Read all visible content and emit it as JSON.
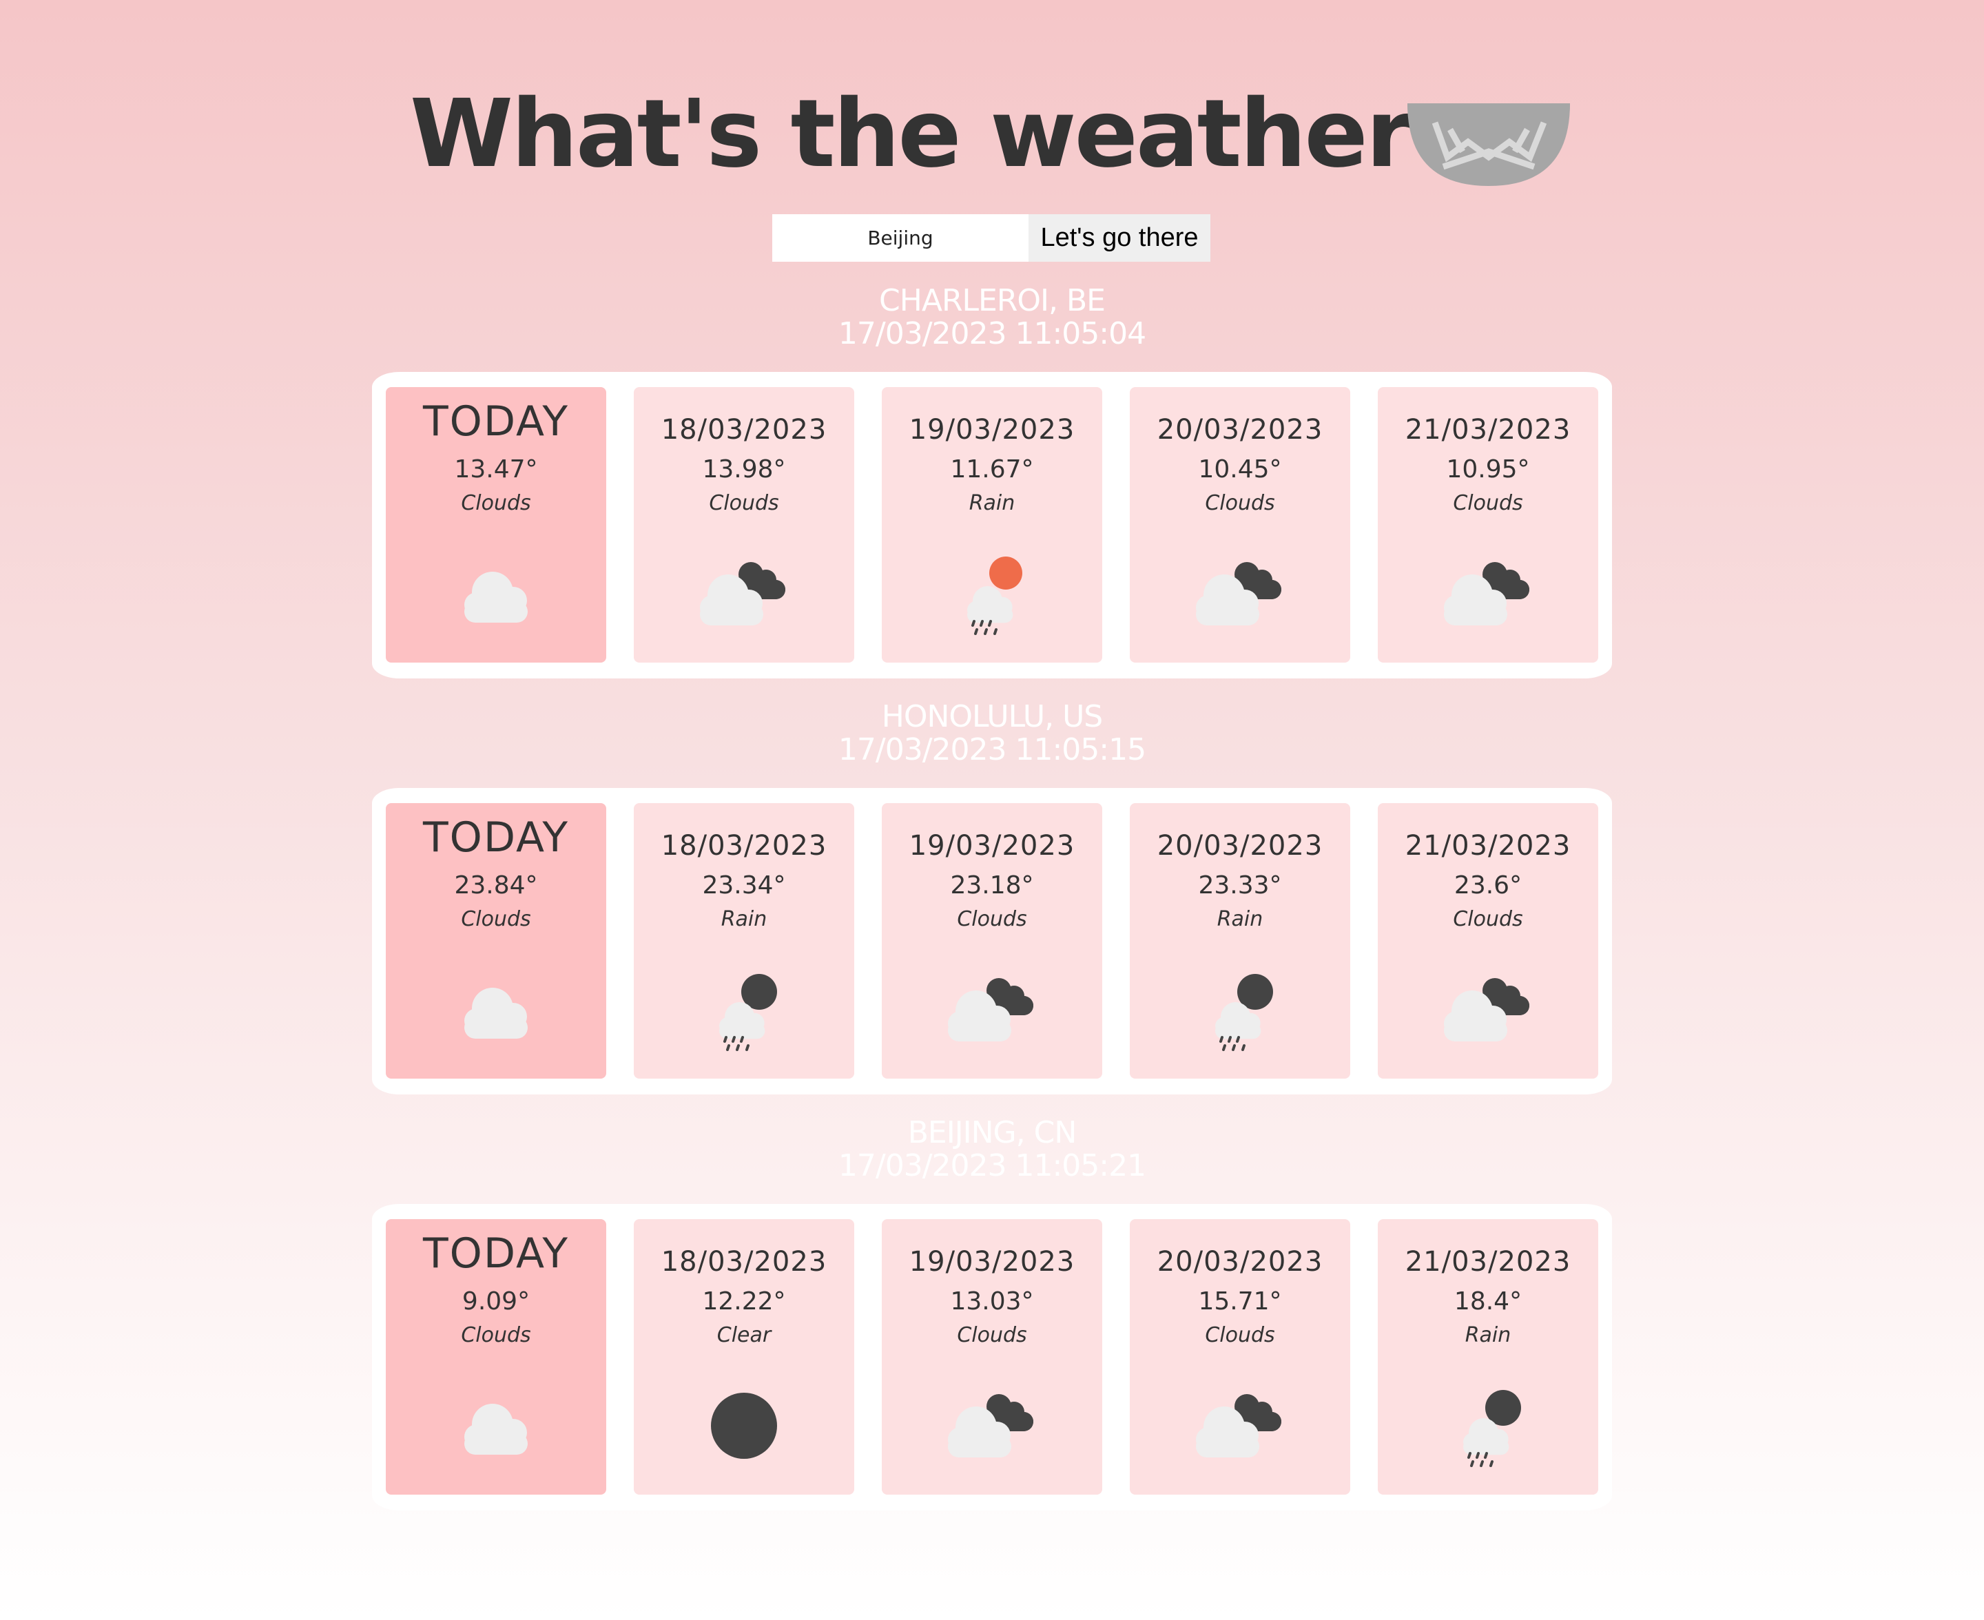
{
  "header": {
    "title": "What's the weather",
    "logo_icon": "stripe-logo-icon"
  },
  "search": {
    "value": "Beijing",
    "button_label": "Let's go there"
  },
  "colors": {
    "today_card": "#fdc1c3",
    "card": "#fde0e1",
    "sun": "#ef6c4a",
    "dark_cloud": "#444444",
    "light_cloud": "#eeeeee"
  },
  "cities": [
    {
      "location": "CHARLEROI, BE",
      "datetime": "17/03/2023 11:05:04",
      "days": [
        {
          "date": "TODAY",
          "temp": "13.47°",
          "desc": "Clouds",
          "icon": "cloud-icon"
        },
        {
          "date": "18/03/2023",
          "temp": "13.98°",
          "desc": "Clouds",
          "icon": "cloudy-night-icon"
        },
        {
          "date": "19/03/2023",
          "temp": "11.67°",
          "desc": "Rain",
          "icon": "rain-sun-icon"
        },
        {
          "date": "20/03/2023",
          "temp": "10.45°",
          "desc": "Clouds",
          "icon": "cloudy-night-icon"
        },
        {
          "date": "21/03/2023",
          "temp": "10.95°",
          "desc": "Clouds",
          "icon": "cloudy-night-icon"
        }
      ]
    },
    {
      "location": "HONOLULU, US",
      "datetime": "17/03/2023 11:05:15",
      "days": [
        {
          "date": "TODAY",
          "temp": "23.84°",
          "desc": "Clouds",
          "icon": "cloud-icon"
        },
        {
          "date": "18/03/2023",
          "temp": "23.34°",
          "desc": "Rain",
          "icon": "rain-night-icon"
        },
        {
          "date": "19/03/2023",
          "temp": "23.18°",
          "desc": "Clouds",
          "icon": "cloudy-night-icon"
        },
        {
          "date": "20/03/2023",
          "temp": "23.33°",
          "desc": "Rain",
          "icon": "rain-night-icon"
        },
        {
          "date": "21/03/2023",
          "temp": "23.6°",
          "desc": "Clouds",
          "icon": "cloudy-night-icon"
        }
      ]
    },
    {
      "location": "BEIJING, CN",
      "datetime": "17/03/2023 11:05:21",
      "days": [
        {
          "date": "TODAY",
          "temp": "9.09°",
          "desc": "Clouds",
          "icon": "cloud-icon"
        },
        {
          "date": "18/03/2023",
          "temp": "12.22°",
          "desc": "Clear",
          "icon": "clear-night-icon"
        },
        {
          "date": "19/03/2023",
          "temp": "13.03°",
          "desc": "Clouds",
          "icon": "cloudy-night-icon"
        },
        {
          "date": "20/03/2023",
          "temp": "15.71°",
          "desc": "Clouds",
          "icon": "cloudy-night-icon"
        },
        {
          "date": "21/03/2023",
          "temp": "18.4°",
          "desc": "Rain",
          "icon": "rain-night-icon"
        }
      ]
    }
  ]
}
